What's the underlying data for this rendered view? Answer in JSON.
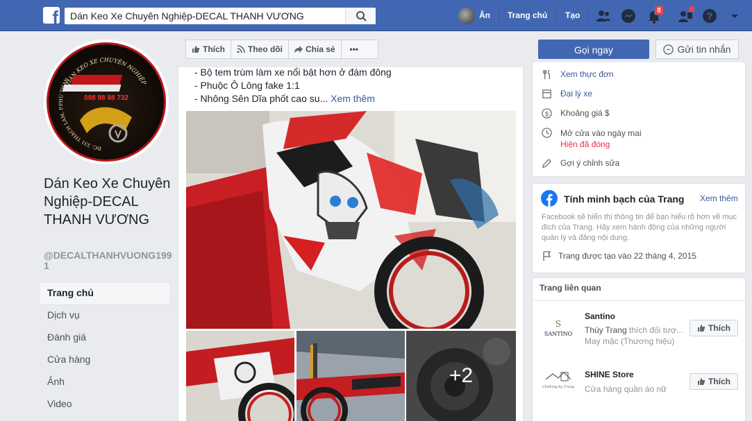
{
  "topbar": {
    "search_value": "Dán Keo Xe Chuyên Nghiệp-DECAL THANH VƯƠNG",
    "user_name": "Ân",
    "home_label": "Trang chủ",
    "create_label": "Tạo",
    "notification_count": "8"
  },
  "profile": {
    "logo_top_text": "DÁN KEO XE CHUYÊN NGHIỆP",
    "logo_phone": "098 98 98 732",
    "logo_address": "ĐC: 331 THẠCH LAM, P.PHÚ THẠNH, Q.TÂN PHÚ,TP.HCM"
  },
  "page": {
    "title": "Dán Keo Xe Chuyên Nghiệp-DECAL THANH VƯƠNG",
    "handle": "@DECALTHANHVUONG1991"
  },
  "left_nav": [
    {
      "label": "Trang chủ",
      "active": true
    },
    {
      "label": "Dịch vụ"
    },
    {
      "label": "Đánh giá"
    },
    {
      "label": "Cửa hàng"
    },
    {
      "label": "Ảnh"
    },
    {
      "label": "Video"
    }
  ],
  "actions": {
    "like": "Thích",
    "follow": "Theo dõi",
    "share": "Chia sẻ",
    "more": "•••",
    "call": "Gọi ngay",
    "message": "Gửi tin nhắn"
  },
  "post": {
    "line1": "- Bộ tem trùm làm xe nổi bật hơn ở đám đông",
    "line2": "- Phuộc Ô Lông fake 1:1",
    "line3": "- Nhông Sên Dĩa phốt cao su...",
    "see_more": "Xem thêm",
    "extra_photos": "+2"
  },
  "about": {
    "menu": "Xem thực đơn",
    "category": "Đại lý xe",
    "price": "Khoảng giá $",
    "hours": "Mở cửa vào ngày mai",
    "status": "Hiện đã đóng",
    "suggest": "Gợi ý chỉnh sửa"
  },
  "transparency": {
    "title": "Tính minh bạch của Trang",
    "see_more": "Xem thêm",
    "description": "Facebook sẽ hiển thị thông tin để bạn hiểu rõ hơn về mục đích của Trang. Hãy xem hành động của những người quản lý và đăng nội dung.",
    "created": "Trang được tạo vào 22 tháng 4, 2015"
  },
  "related": {
    "heading": "Trang liên quan",
    "pages": [
      {
        "name": "Santino",
        "friend": "Thùy Trang",
        "friend_suffix": " thích đối tượ...",
        "category": "May mặc (Thương hiệu)",
        "logo_text": "SANTINO",
        "like": "Thích"
      },
      {
        "name": "SHINE Store",
        "category": "Cửa hàng quần áo nữ",
        "logo_text": "Clothing by Trang",
        "like": "Thích"
      }
    ]
  },
  "colors": {
    "brand_blue": "#4267b2",
    "link": "#365899",
    "closed_red": "#f02849"
  }
}
